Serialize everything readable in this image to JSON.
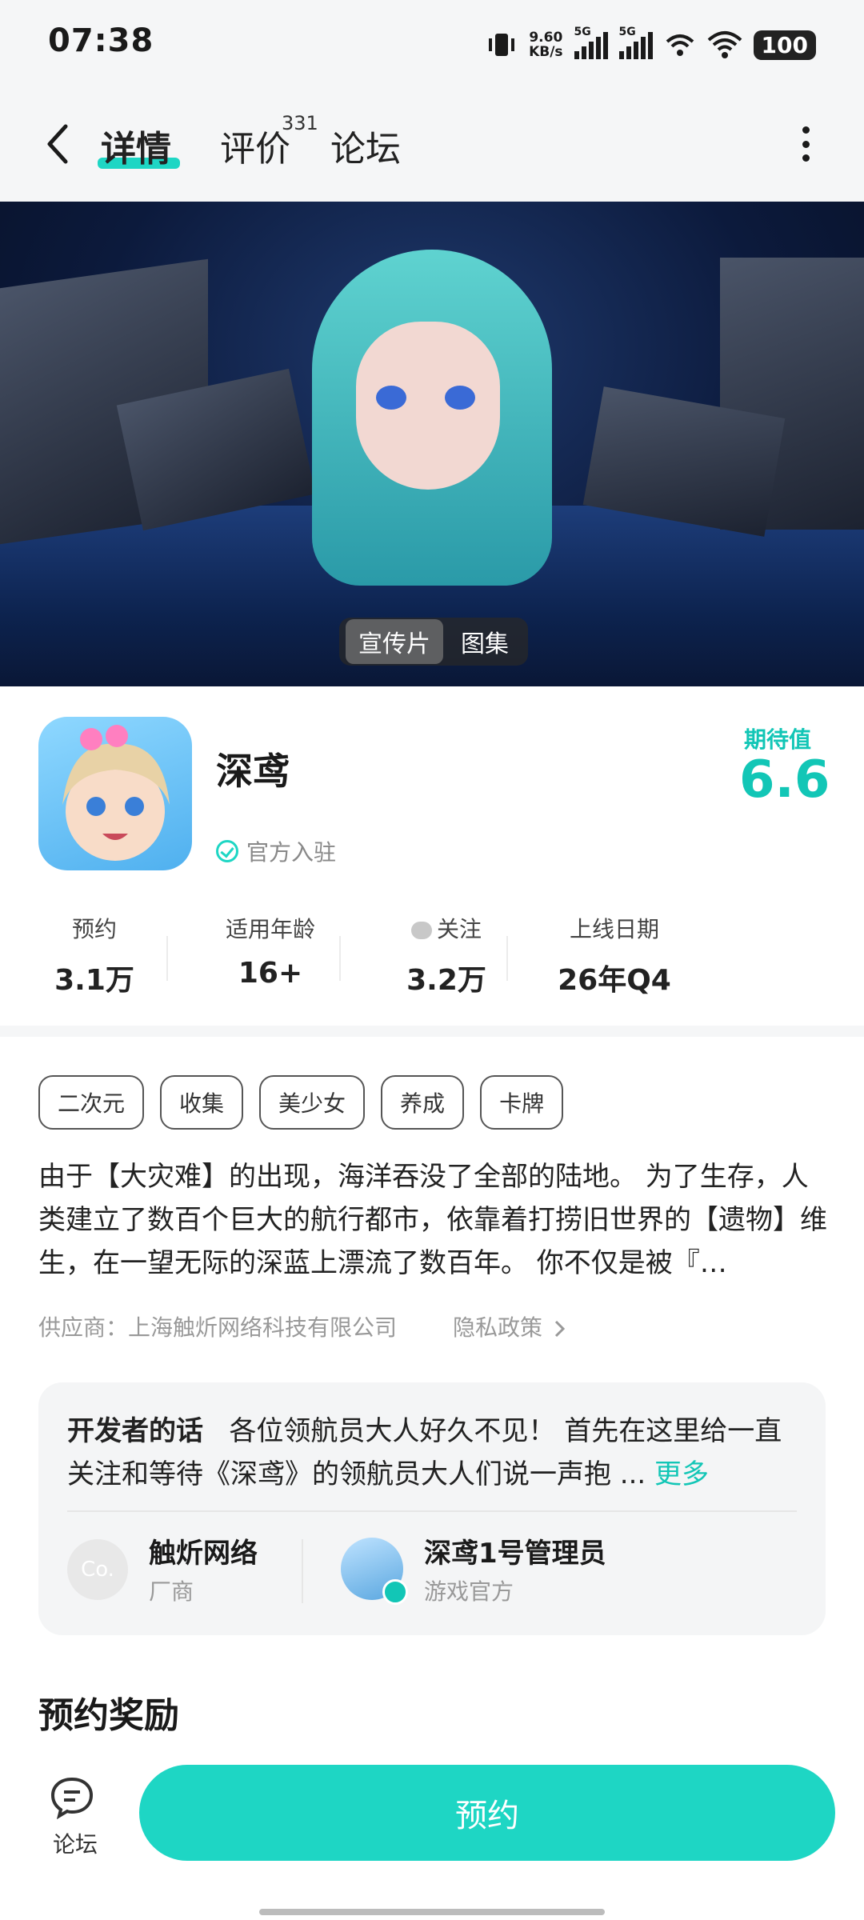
{
  "status_bar": {
    "time": "07:38",
    "net_speed_value": "9.60",
    "net_speed_unit": "KB/s",
    "signal1_label": "5G",
    "signal2_label": "5G",
    "battery": "100"
  },
  "header": {
    "tabs": [
      {
        "label": "详情",
        "active": true
      },
      {
        "label": "评价",
        "badge": "331"
      },
      {
        "label": "论坛"
      }
    ]
  },
  "banner": {
    "toggles": [
      "宣传片",
      "图集"
    ],
    "selected": "宣传片"
  },
  "game": {
    "title": "深鸢",
    "official_label": "官方入驻",
    "expectation_label": "期待值",
    "expectation_value": "6.6",
    "stats": [
      {
        "label": "预约",
        "value": "3.1万"
      },
      {
        "label": "适用年龄",
        "value": "16+"
      },
      {
        "label": "关注",
        "value": "3.2万"
      },
      {
        "label": "上线日期",
        "value": "26年Q4"
      }
    ]
  },
  "tags": [
    "二次元",
    "收集",
    "美少女",
    "养成",
    "卡牌"
  ],
  "description": "由于【大灾难】的出现，海洋吞没了全部的陆地。 为了生存，人类建立了数百个巨大的航行都市，依靠着打捞旧世界的【遗物】维生，在一望无际的深蓝上漂流了数百年。 你不仅是被『…",
  "supplier": "供应商：上海触炘网络科技有限公司",
  "privacy": "隐私政策",
  "developer_note": {
    "label": "开发者的话",
    "text": "各位领航员大人好久不见！ 首先在这里给一直关注和等待《深鸢》的领航员大人们说一声抱 ...",
    "more": "更多",
    "accounts": [
      {
        "name": "触炘网络",
        "role": "厂商",
        "avatar_text": "Co."
      },
      {
        "name": "深鸢1号管理员",
        "role": "游戏官方"
      }
    ]
  },
  "section_title": "预约奖励",
  "bottom_bar": {
    "forum_label": "论坛",
    "reserve_button": "预约"
  },
  "colors": {
    "accent": "#1ed6c4",
    "accent_text": "#12c6b6"
  }
}
